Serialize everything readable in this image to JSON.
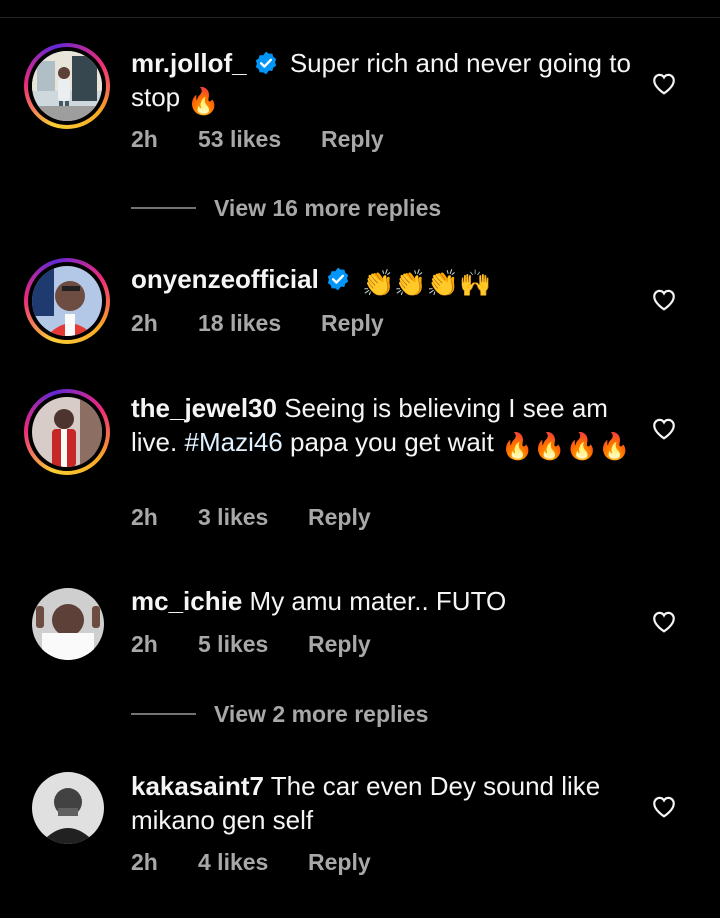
{
  "colors": {
    "background": "#000000",
    "text": "#f5f5f5",
    "muted": "#a8a8a8",
    "verified": "#0095f6",
    "hashtag": "#e0f1ff"
  },
  "comments": [
    {
      "username": "mr.jollof_",
      "verified": true,
      "text": "Super rich and never going to stop",
      "emojis": "🔥",
      "time": "2h",
      "likes": "53 likes",
      "reply": "Reply",
      "view_more": "View 16 more replies"
    },
    {
      "username": "onyenzeofficial",
      "verified": true,
      "text": "",
      "emojis": "👏👏👏🙌",
      "time": "2h",
      "likes": "18 likes",
      "reply": "Reply"
    },
    {
      "username": "the_jewel30",
      "verified": false,
      "text_before": "Seeing is believing I see am live.",
      "hashtag": "#Mazi46",
      "text_after": "papa you get wait",
      "emojis": "🔥🔥🔥🔥",
      "time": "2h",
      "likes": "3 likes",
      "reply": "Reply"
    },
    {
      "username": "mc_ichie",
      "verified": false,
      "text": "My amu mater.. FUTO",
      "time": "2h",
      "likes": "5 likes",
      "reply": "Reply",
      "view_more": "View 2 more replies"
    },
    {
      "username": "kakasaint7",
      "verified": false,
      "text": "The car even Dey sound like mikano gen self",
      "time": "2h",
      "likes": "4 likes",
      "reply": "Reply"
    }
  ],
  "icons": {
    "verified": "verified-badge-icon",
    "like": "heart-outline-icon"
  }
}
